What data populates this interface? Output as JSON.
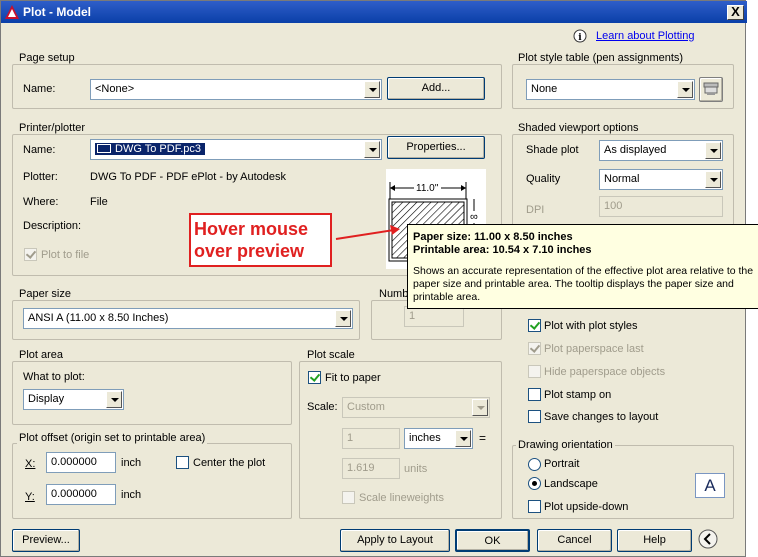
{
  "window": {
    "title": "Plot - Model",
    "close_glyph": "X"
  },
  "help_link": "Learn about Plotting",
  "page_setup": {
    "group_title": "Page setup",
    "name_label": "Name:",
    "name_value": "<None>",
    "add_button": "Add..."
  },
  "printer": {
    "group_title": "Printer/plotter",
    "name_label": "Name:",
    "name_value": "DWG To PDF.pc3",
    "properties_button": "Properties...",
    "plotter_label": "Plotter:",
    "plotter_value": "DWG To PDF - PDF ePlot - by Autodesk",
    "where_label": "Where:",
    "where_value": "File",
    "description_label": "Description:",
    "plot_to_file": "Plot to file",
    "preview_dim": "11.0''"
  },
  "annotation": {
    "line1": "Hover mouse",
    "line2": "over preview"
  },
  "tooltip": {
    "paper_size": "Paper size:  11.00 x 8.50 inches",
    "printable_area": "Printable area:  10.54 x 7.10 inches",
    "body": "Shows an accurate representation of the effective plot area relative to the paper size and printable area. The tooltip displays the paper size and printable area."
  },
  "paper_size": {
    "group_title": "Paper size",
    "value": "ANSI A (11.00 x 8.50 Inches)"
  },
  "copies": {
    "group_title": "Numb",
    "value": "1"
  },
  "plot_area": {
    "group_title": "Plot area",
    "what_label": "What to plot:",
    "value": "Display"
  },
  "plot_offset": {
    "group_title": "Plot offset (origin set to printable area)",
    "x_label": "X:",
    "x_value": "0.000000",
    "y_label": "Y:",
    "y_value": "0.000000",
    "unit": "inch",
    "center": "Center the plot"
  },
  "plot_scale": {
    "group_title": "Plot scale",
    "fit": "Fit to paper",
    "scale_label": "Scale:",
    "scale_value": "Custom",
    "num_value": "1",
    "unit_value": "inches",
    "equals": "=",
    "den_value": "1.619",
    "den_unit": "units",
    "scale_lw": "Scale lineweights"
  },
  "plot_style_table": {
    "group_title": "Plot style table (pen assignments)",
    "value": "None"
  },
  "shaded": {
    "group_title": "Shaded viewport options",
    "shade_label": "Shade plot",
    "shade_value": "As displayed",
    "quality_label": "Quality",
    "quality_value": "Normal",
    "dpi_label": "DPI",
    "dpi_value": "100"
  },
  "options": {
    "plot_styles": "Plot with plot styles",
    "paperspace_last": "Plot paperspace last",
    "hide_objects": "Hide paperspace objects",
    "stamp": "Plot stamp on",
    "save_changes": "Save changes to layout"
  },
  "orientation": {
    "group_title": "Drawing orientation",
    "portrait": "Portrait",
    "landscape": "Landscape",
    "upside_down": "Plot upside-down",
    "icon_letter": "A"
  },
  "buttons": {
    "preview": "Preview...",
    "apply": "Apply to Layout",
    "ok": "OK",
    "cancel": "Cancel",
    "help": "Help"
  },
  "colors": {
    "title_bar": "#0a3fa8",
    "annotation": "#e02020",
    "tooltip_bg": "#ffffe1"
  }
}
